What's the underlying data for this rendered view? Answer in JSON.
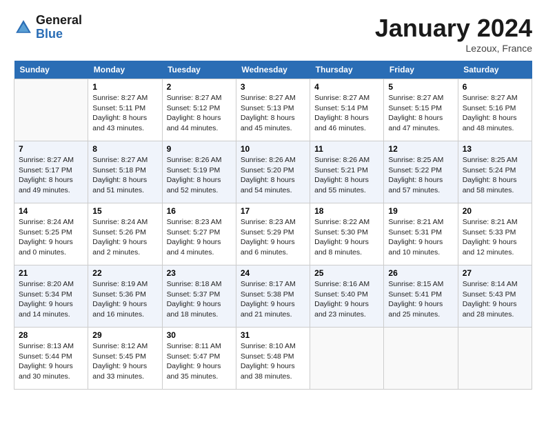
{
  "header": {
    "logo_line1": "General",
    "logo_line2": "Blue",
    "month": "January 2024",
    "location": "Lezoux, France"
  },
  "days_of_week": [
    "Sunday",
    "Monday",
    "Tuesday",
    "Wednesday",
    "Thursday",
    "Friday",
    "Saturday"
  ],
  "weeks": [
    [
      {
        "day": "",
        "info": ""
      },
      {
        "day": "1",
        "info": "Sunrise: 8:27 AM\nSunset: 5:11 PM\nDaylight: 8 hours\nand 43 minutes."
      },
      {
        "day": "2",
        "info": "Sunrise: 8:27 AM\nSunset: 5:12 PM\nDaylight: 8 hours\nand 44 minutes."
      },
      {
        "day": "3",
        "info": "Sunrise: 8:27 AM\nSunset: 5:13 PM\nDaylight: 8 hours\nand 45 minutes."
      },
      {
        "day": "4",
        "info": "Sunrise: 8:27 AM\nSunset: 5:14 PM\nDaylight: 8 hours\nand 46 minutes."
      },
      {
        "day": "5",
        "info": "Sunrise: 8:27 AM\nSunset: 5:15 PM\nDaylight: 8 hours\nand 47 minutes."
      },
      {
        "day": "6",
        "info": "Sunrise: 8:27 AM\nSunset: 5:16 PM\nDaylight: 8 hours\nand 48 minutes."
      }
    ],
    [
      {
        "day": "7",
        "info": "Sunrise: 8:27 AM\nSunset: 5:17 PM\nDaylight: 8 hours\nand 49 minutes."
      },
      {
        "day": "8",
        "info": "Sunrise: 8:27 AM\nSunset: 5:18 PM\nDaylight: 8 hours\nand 51 minutes."
      },
      {
        "day": "9",
        "info": "Sunrise: 8:26 AM\nSunset: 5:19 PM\nDaylight: 8 hours\nand 52 minutes."
      },
      {
        "day": "10",
        "info": "Sunrise: 8:26 AM\nSunset: 5:20 PM\nDaylight: 8 hours\nand 54 minutes."
      },
      {
        "day": "11",
        "info": "Sunrise: 8:26 AM\nSunset: 5:21 PM\nDaylight: 8 hours\nand 55 minutes."
      },
      {
        "day": "12",
        "info": "Sunrise: 8:25 AM\nSunset: 5:22 PM\nDaylight: 8 hours\nand 57 minutes."
      },
      {
        "day": "13",
        "info": "Sunrise: 8:25 AM\nSunset: 5:24 PM\nDaylight: 8 hours\nand 58 minutes."
      }
    ],
    [
      {
        "day": "14",
        "info": "Sunrise: 8:24 AM\nSunset: 5:25 PM\nDaylight: 9 hours\nand 0 minutes."
      },
      {
        "day": "15",
        "info": "Sunrise: 8:24 AM\nSunset: 5:26 PM\nDaylight: 9 hours\nand 2 minutes."
      },
      {
        "day": "16",
        "info": "Sunrise: 8:23 AM\nSunset: 5:27 PM\nDaylight: 9 hours\nand 4 minutes."
      },
      {
        "day": "17",
        "info": "Sunrise: 8:23 AM\nSunset: 5:29 PM\nDaylight: 9 hours\nand 6 minutes."
      },
      {
        "day": "18",
        "info": "Sunrise: 8:22 AM\nSunset: 5:30 PM\nDaylight: 9 hours\nand 8 minutes."
      },
      {
        "day": "19",
        "info": "Sunrise: 8:21 AM\nSunset: 5:31 PM\nDaylight: 9 hours\nand 10 minutes."
      },
      {
        "day": "20",
        "info": "Sunrise: 8:21 AM\nSunset: 5:33 PM\nDaylight: 9 hours\nand 12 minutes."
      }
    ],
    [
      {
        "day": "21",
        "info": "Sunrise: 8:20 AM\nSunset: 5:34 PM\nDaylight: 9 hours\nand 14 minutes."
      },
      {
        "day": "22",
        "info": "Sunrise: 8:19 AM\nSunset: 5:36 PM\nDaylight: 9 hours\nand 16 minutes."
      },
      {
        "day": "23",
        "info": "Sunrise: 8:18 AM\nSunset: 5:37 PM\nDaylight: 9 hours\nand 18 minutes."
      },
      {
        "day": "24",
        "info": "Sunrise: 8:17 AM\nSunset: 5:38 PM\nDaylight: 9 hours\nand 21 minutes."
      },
      {
        "day": "25",
        "info": "Sunrise: 8:16 AM\nSunset: 5:40 PM\nDaylight: 9 hours\nand 23 minutes."
      },
      {
        "day": "26",
        "info": "Sunrise: 8:15 AM\nSunset: 5:41 PM\nDaylight: 9 hours\nand 25 minutes."
      },
      {
        "day": "27",
        "info": "Sunrise: 8:14 AM\nSunset: 5:43 PM\nDaylight: 9 hours\nand 28 minutes."
      }
    ],
    [
      {
        "day": "28",
        "info": "Sunrise: 8:13 AM\nSunset: 5:44 PM\nDaylight: 9 hours\nand 30 minutes."
      },
      {
        "day": "29",
        "info": "Sunrise: 8:12 AM\nSunset: 5:45 PM\nDaylight: 9 hours\nand 33 minutes."
      },
      {
        "day": "30",
        "info": "Sunrise: 8:11 AM\nSunset: 5:47 PM\nDaylight: 9 hours\nand 35 minutes."
      },
      {
        "day": "31",
        "info": "Sunrise: 8:10 AM\nSunset: 5:48 PM\nDaylight: 9 hours\nand 38 minutes."
      },
      {
        "day": "",
        "info": ""
      },
      {
        "day": "",
        "info": ""
      },
      {
        "day": "",
        "info": ""
      }
    ]
  ]
}
